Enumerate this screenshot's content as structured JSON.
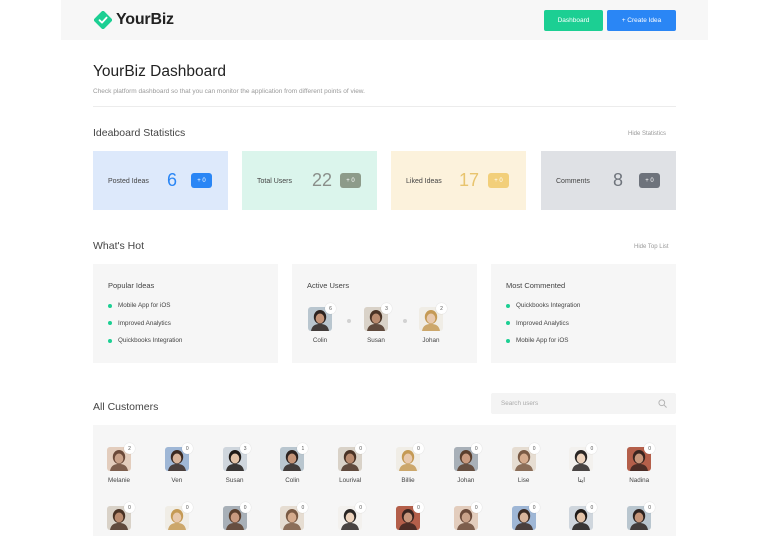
{
  "app": {
    "logo_text": "YourBiz"
  },
  "header": {
    "dashboard_button": "Dashboard",
    "create_button": "+ Create Idea"
  },
  "page": {
    "title": "YourBiz Dashboard",
    "subtitle": "Check platform dashboard so that you can monitor the application from different points of view."
  },
  "stats_section": {
    "title": "Ideaboard Statistics",
    "hide_link": "Hide Statistics",
    "cards": [
      {
        "label": "Posted Ideas",
        "value": "6",
        "delta": "+ 0",
        "bg": "#dde9fb",
        "value_color": "#2a86f5",
        "badge_color": "#2a86f5"
      },
      {
        "label": "Total Users",
        "value": "22",
        "delta": "+ 0",
        "bg": "#dbf5ec",
        "value_color": "#8a8f8a",
        "badge_color": "#8d9b8a"
      },
      {
        "label": "Liked Ideas",
        "value": "17",
        "delta": "+ 0",
        "bg": "#fcf2dc",
        "value_color": "#e8c46e",
        "badge_color": "#f2cf7a"
      },
      {
        "label": "Comments",
        "value": "8",
        "delta": "+ 0",
        "bg": "#dfe1e5",
        "value_color": "#6f747c",
        "badge_color": "#6e737c"
      }
    ]
  },
  "hot_section": {
    "title": "What's Hot",
    "hide_link": "Hide Top List",
    "popular": {
      "title": "Popular Ideas",
      "items": [
        "Mobile App for iOS",
        "Improved Analytics",
        "Quickbooks Integration"
      ]
    },
    "active": {
      "title": "Active Users",
      "users": [
        {
          "name": "Colin",
          "count": "6"
        },
        {
          "name": "Susan",
          "count": "3"
        },
        {
          "name": "Johan",
          "count": "2"
        }
      ]
    },
    "commented": {
      "title": "Most Commented",
      "items": [
        "Quickbooks Integration",
        "Improved Analytics",
        "Mobile App for iOS"
      ]
    }
  },
  "customers_section": {
    "title": "All Customers",
    "search_placeholder": "Search users",
    "row1": [
      {
        "name": "Melanie",
        "count": "2"
      },
      {
        "name": "Ven",
        "count": "0"
      },
      {
        "name": "Susan",
        "count": "3"
      },
      {
        "name": "Colin",
        "count": "1"
      },
      {
        "name": "Lourival",
        "count": "0"
      },
      {
        "name": "Billie",
        "count": "0"
      },
      {
        "name": "Johan",
        "count": "0"
      },
      {
        "name": "Lise",
        "count": "0"
      },
      {
        "name": "ايتا",
        "count": "0"
      },
      {
        "name": "Nadina",
        "count": "0"
      }
    ],
    "row2": [
      {
        "count": "0"
      },
      {
        "count": "0"
      },
      {
        "count": "0"
      },
      {
        "count": "0"
      },
      {
        "count": "0"
      },
      {
        "count": "0"
      },
      {
        "count": "0"
      },
      {
        "count": "0"
      },
      {
        "count": "0"
      },
      {
        "count": "0"
      }
    ]
  }
}
